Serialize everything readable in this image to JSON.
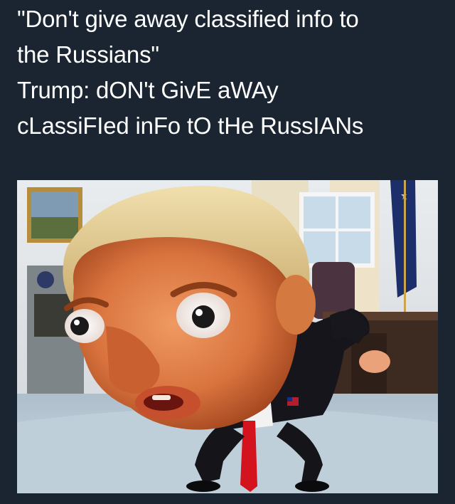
{
  "post": {
    "caption_lines": [
      "\"Don't give away classified info to",
      "the Russians\"",
      "Trump: dON't GivE aWAy",
      "cLassiFIed inFo tO tHe RussIANs"
    ]
  },
  "image": {
    "subject": "cartoon-meme-figure",
    "setting": "office-interior"
  },
  "colors": {
    "background": "#1b2531",
    "caption_text": "#ffffff"
  }
}
